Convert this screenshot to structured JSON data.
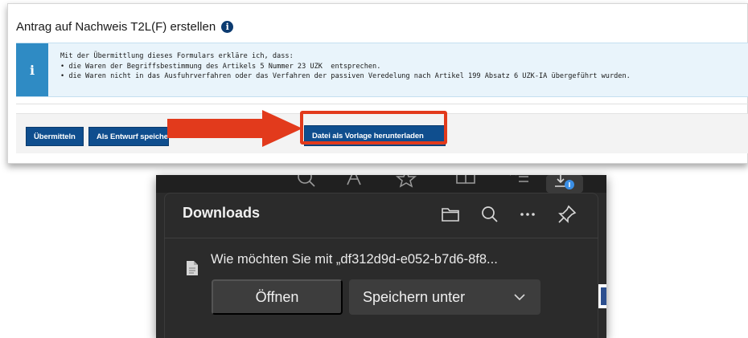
{
  "form": {
    "title": "Antrag auf Nachweis T2L(F) erstellen",
    "info_lines": [
      "Mit der Übermittlung dieses Formulars erkläre ich, dass:",
      "• die Waren der Begriffsbestimmung des Artikels 5 Nummer 23 UZK  entsprechen.",
      "• die Waren nicht in das Ausfuhrverfahren oder das Verfahren der passiven Veredelung nach Artikel 199 Absatz 6 UZK-IA übergeführt wurden."
    ],
    "buttons": {
      "submit": "Übermitteln",
      "draft": "Als Entwurf speichern",
      "template": "Datei als Vorlage herunterladen"
    }
  },
  "downloads": {
    "title": "Downloads",
    "prompt": "Wie möchten Sie mit „df312d9d-e052-b7d6-8f8...",
    "open_label": "Öffnen",
    "save_label": "Speichern unter"
  },
  "colors": {
    "accent_blue": "#0f4e8e",
    "info_blue": "#2f8bc4",
    "highlight_red": "#e23a1c",
    "dark_panel": "#2b2b2b",
    "download_badge": "#3b8fe6"
  },
  "icons": {
    "title_info": "info-circle-icon",
    "info_box": "info-icon",
    "arrow": "red-arrow-right",
    "header": [
      "folder-icon",
      "search-icon",
      "more-icon",
      "pin-icon"
    ],
    "toolbar": [
      "search-icon",
      "read-aloud-icon",
      "favorite-icon",
      "split-screen-icon",
      "favorites-list-icon",
      "downloads-icon"
    ],
    "file": "file-icon",
    "save_dropdown": "chevron-down-icon"
  }
}
